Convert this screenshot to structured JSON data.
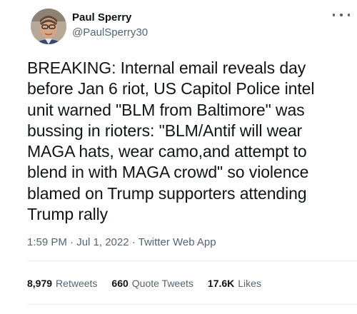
{
  "author": {
    "display_name": "Paul Sperry",
    "handle": "@PaulSperry30",
    "avatar_icon": "profile-photo"
  },
  "tweet": {
    "text": "BREAKING: Internal email reveals day\nbefore Jan 6 riot, US Capitol Police intel\nunit warned \"BLM from Baltimore\" was\nbussing in rioters: \"BLM/Antif will wear\nMAGA hats, wear camo,and attempt to\nblend in with MAGA crowd\" so violence\nblamed on Trump supporters attending\nTrump rally",
    "meta": "1:59 PM · Jul 1, 2022 · Twitter Web App"
  },
  "stats": {
    "retweets_count": "8,979",
    "retweets_label": "Retweets",
    "quotes_count": "660",
    "quotes_label": "Quote Tweets",
    "likes_count": "17.6K",
    "likes_label": "Likes"
  },
  "colors": {
    "text_primary": "#0f1419",
    "text_secondary": "#536471",
    "divider": "#eff3f4"
  }
}
